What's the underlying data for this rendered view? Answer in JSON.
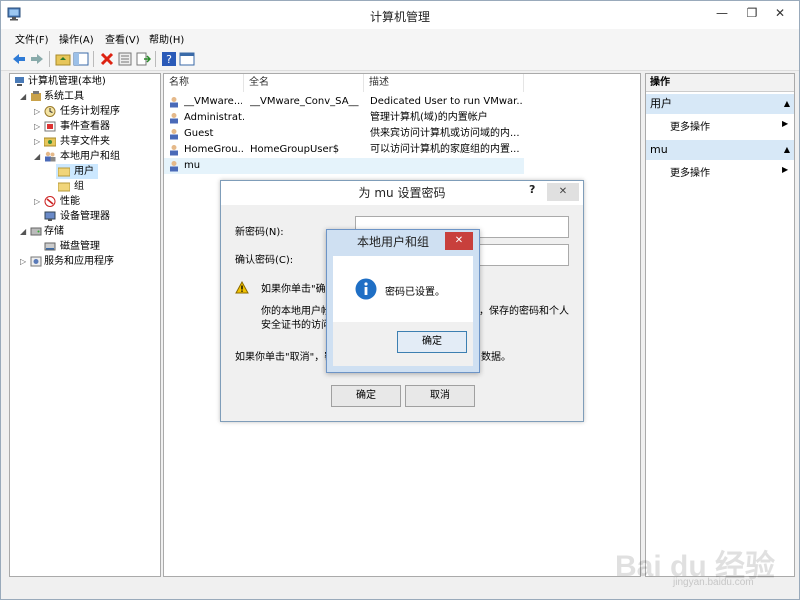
{
  "window": {
    "title": "计算机管理"
  },
  "menu": {
    "file": "文件(F)",
    "action": "操作(A)",
    "view": "查看(V)",
    "help": "帮助(H)"
  },
  "tree": {
    "root": "计算机管理(本地)",
    "system_tools": "系统工具",
    "task_scheduler": "任务计划程序",
    "event_viewer": "事件查看器",
    "shared_folders": "共享文件夹",
    "local_users_groups": "本地用户和组",
    "users": "用户",
    "groups": "组",
    "performance": "性能",
    "device_manager": "设备管理器",
    "storage": "存储",
    "disk_management": "磁盘管理",
    "services_apps": "服务和应用程序"
  },
  "list": {
    "headers": {
      "name": "名称",
      "fullname": "全名",
      "desc": "描述"
    },
    "rows": [
      {
        "name": "__VMware...",
        "fullname": "__VMware_Conv_SA__",
        "desc": "Dedicated User to run VMwar..."
      },
      {
        "name": "Administrat...",
        "fullname": "",
        "desc": "管理计算机(域)的内置帐户"
      },
      {
        "name": "Guest",
        "fullname": "",
        "desc": "供来宾访问计算机或访问域的内..."
      },
      {
        "name": "HomeGrou...",
        "fullname": "HomeGroupUser$",
        "desc": "可以访问计算机的家庭组的内置..."
      },
      {
        "name": "mu",
        "fullname": "",
        "desc": ""
      }
    ]
  },
  "actions": {
    "title": "操作",
    "sec1": "用户",
    "sec1_more": "更多操作",
    "sec2": "mu",
    "sec2_more": "更多操作"
  },
  "pwd_dialog": {
    "title": "为 mu 设置密码",
    "help": "?",
    "new_pwd_label": "新密码(N):",
    "confirm_pwd_label": "确认密码(C):",
    "warn_line1": "如果你单击\"确定",
    "warn_line2": "你的本地用户帐",
    "warn_line2b": "，保存的密码和个人",
    "warn_line3": "安全证书的访问",
    "cancel_note": "如果你单击\"取消\"，密",
    "cancel_note_b": "数据。",
    "ok": "确定",
    "cancel": "取消"
  },
  "msg_dialog": {
    "title": "本地用户和组",
    "text": "密码已设置。",
    "ok": "确定"
  },
  "watermark": {
    "brand": "Bai du 经验",
    "url": "jingyan.baidu.com"
  }
}
